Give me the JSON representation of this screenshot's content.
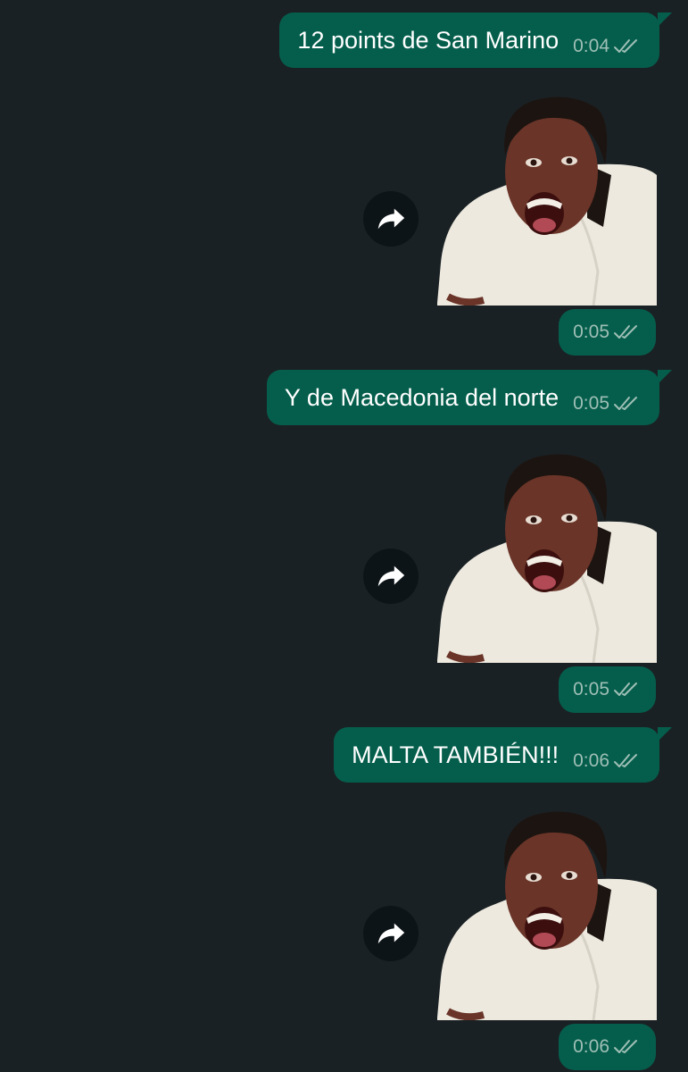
{
  "chat": {
    "messages": [
      {
        "type": "text",
        "text": "12 points de San Marino",
        "time": "0:04",
        "status": "read"
      },
      {
        "type": "sticker",
        "sticker": "screaming-woman-sticker",
        "time": "0:05",
        "status": "read"
      },
      {
        "type": "text",
        "text": "Y de Macedonia del norte",
        "time": "0:05",
        "status": "read"
      },
      {
        "type": "sticker",
        "sticker": "screaming-woman-sticker",
        "time": "0:05",
        "status": "read"
      },
      {
        "type": "text",
        "text": "MALTA TAMBIÉN!!!",
        "time": "0:06",
        "status": "read"
      },
      {
        "type": "sticker",
        "sticker": "screaming-woman-sticker",
        "time": "0:06",
        "status": "read"
      }
    ]
  },
  "icons": {
    "forward": "forward-arrow-icon",
    "read_receipt": "double-check-icon"
  },
  "colors": {
    "background": "#1a2124",
    "bubble": "#055e4c",
    "timestamp": "#9fbfb6"
  }
}
